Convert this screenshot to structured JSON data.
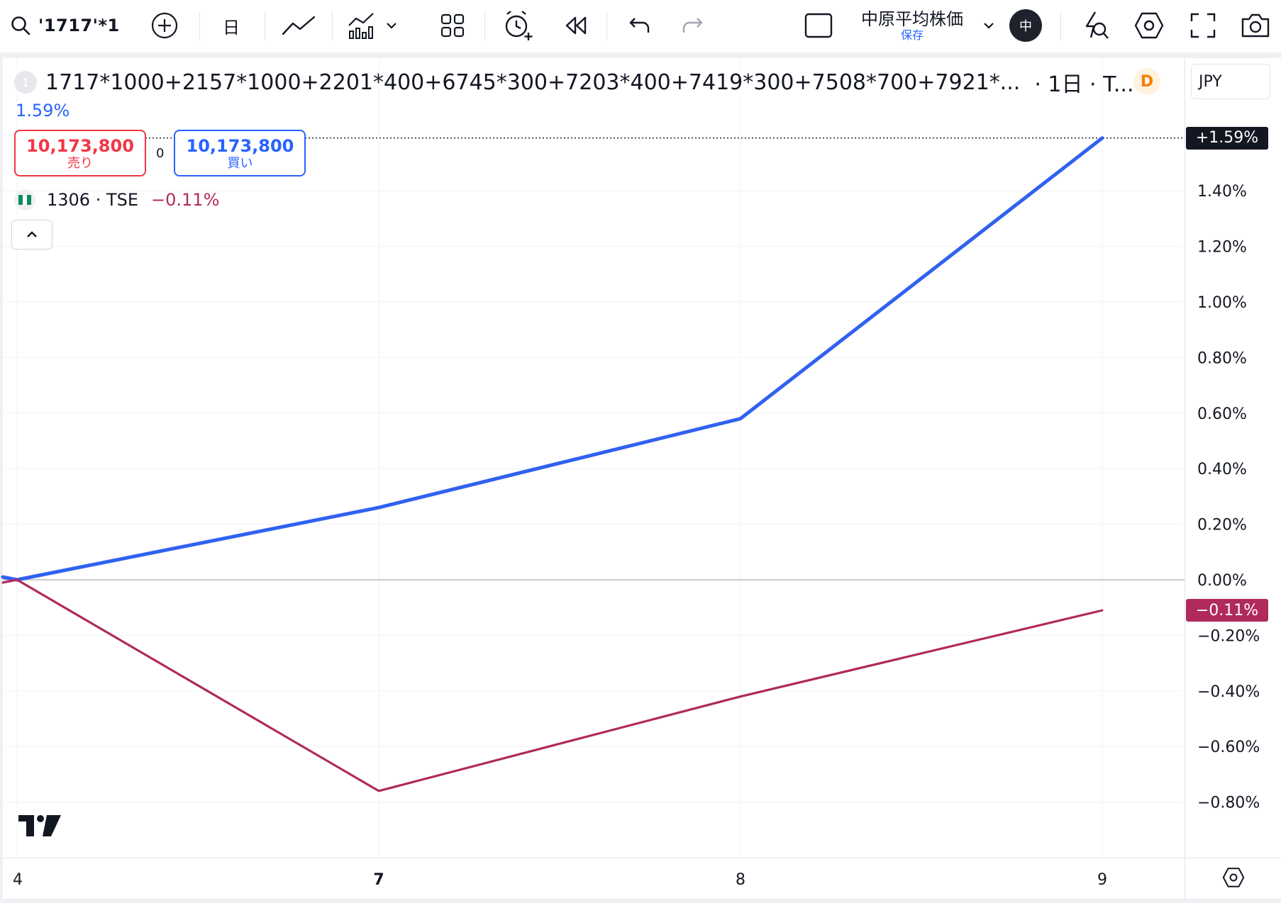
{
  "toolbar": {
    "symbol": "'1717'*1",
    "interval": "日",
    "layout_name": "中原平均株価",
    "layout_status": "保存",
    "avatar": "中",
    "icons": [
      "search-icon",
      "plus-circle-icon",
      "line-chart-icon",
      "indicators-icon",
      "chevron-down-icon",
      "layouts-icon",
      "alarm-add-icon",
      "replay-icon",
      "undo-icon",
      "redo-icon",
      "square-icon",
      "chevron-down-icon",
      "lightning-search-icon",
      "hexagon-settings-icon",
      "fullscreen-icon",
      "camera-icon"
    ]
  },
  "legend": {
    "badge": "1",
    "expression": "1717*1000+2157*1000+2201*400+6745*300+7203*400+7419*300+7508*700+7921*...",
    "interval_exchange": "· 1日 · T...",
    "data_badge": "D",
    "percent": "1.59%",
    "sell_price": "10,173,800",
    "sell_label": "売り",
    "spread": "0",
    "buy_price": "10,173,800",
    "buy_label": "買い",
    "compare_symbol": "1306 · TSE",
    "compare_percent": "−0.11%"
  },
  "price_scale": {
    "currency": "JPY",
    "main_badge": "+1.59%",
    "compare_badge": "−0.11%",
    "ticks": [
      "1.40%",
      "1.20%",
      "1.00%",
      "0.80%",
      "0.60%",
      "0.40%",
      "0.20%",
      "0.00%",
      "−0.20%",
      "−0.40%",
      "−0.60%",
      "−0.80%"
    ]
  },
  "time_scale": {
    "labels": [
      "4",
      "7",
      "8",
      "9"
    ],
    "bold": [
      false,
      true,
      false,
      false
    ]
  },
  "colors": {
    "main": "#3061f0",
    "compare": "#b02a5c",
    "grid": "#f0f3fa"
  },
  "chart_data": {
    "type": "line",
    "x": [
      "4",
      "7",
      "8",
      "9"
    ],
    "ylim": [
      -0.9,
      1.68
    ],
    "series": [
      {
        "name": "1717*1000+2157*1000+2201*400+6745*300+7203*400+7419*300+7508*700+7921*...",
        "values": [
          0.0,
          0.26,
          0.58,
          1.59
        ],
        "color": "#3061f0"
      },
      {
        "name": "1306 · TSE",
        "values": [
          0.0,
          -0.76,
          -0.42,
          -0.11
        ],
        "color": "#b02a5c"
      }
    ],
    "grid": true,
    "legend_position": "top-left"
  }
}
